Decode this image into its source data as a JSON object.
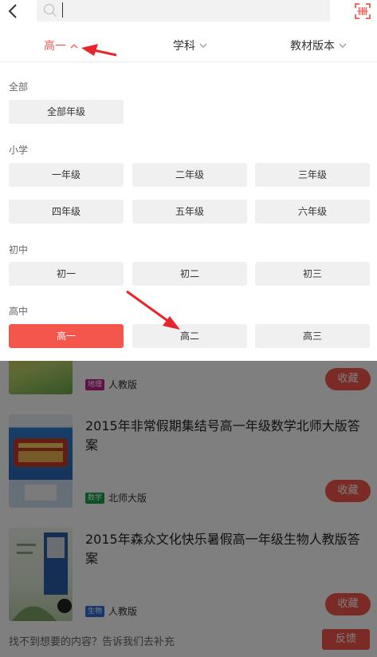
{
  "header": {
    "search": {
      "value": "",
      "placeholder": ""
    }
  },
  "filters": [
    {
      "label": "高一",
      "active": true,
      "expanded": true
    },
    {
      "label": "学科",
      "active": false
    },
    {
      "label": "教材版本",
      "active": false
    }
  ],
  "grade_panel": {
    "all": {
      "title": "全部",
      "options": [
        "全部年级"
      ]
    },
    "primary": {
      "title": "小学",
      "options": [
        "一年级",
        "二年级",
        "三年级",
        "四年级",
        "五年级",
        "六年级"
      ]
    },
    "junior": {
      "title": "初中",
      "options": [
        "初一",
        "初二",
        "初三"
      ]
    },
    "senior": {
      "title": "高中",
      "options": [
        "高一",
        "高二",
        "高三"
      ]
    },
    "selected": "高一"
  },
  "books": [
    {
      "title": "",
      "subject": "地理",
      "subject_color": "#c0208a",
      "edition": "人教版",
      "fav_label": "收藏"
    },
    {
      "title": "2015年非常假期集结号高一年级数学北师大版答案",
      "subject": "数学",
      "subject_color": "#19a14a",
      "edition": "北师大版",
      "fav_label": "收藏"
    },
    {
      "title": "2015年森众文化快乐暑假高一年级生物人教版答案",
      "subject": "生物",
      "subject_color": "#2a6fd6",
      "edition": "人教版",
      "fav_label": "收藏"
    }
  ],
  "footer": {
    "text": "找不到想要的内容？告诉我们去补充",
    "feedback_label": "反馈"
  },
  "colors": {
    "accent": "#f5564b",
    "arrow": "#e8252b"
  }
}
